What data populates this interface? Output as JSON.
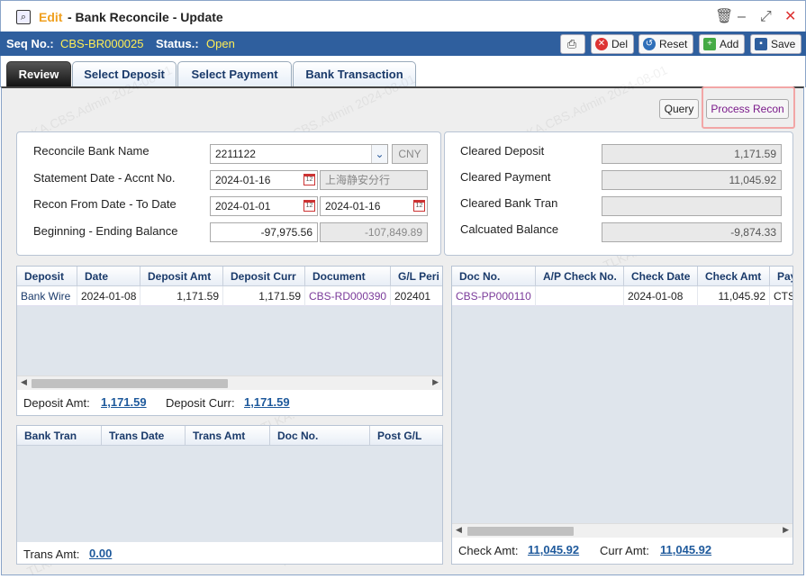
{
  "window": {
    "title_mode": "Edit",
    "title_rest": "- Bank Reconcile - Update",
    "controls": {
      "delete": "🗑",
      "minimize": "–",
      "maximize": "⤢",
      "close": "✕"
    }
  },
  "seqbar": {
    "seq_label": "Seq No.:",
    "seq_value": "CBS-BR000025",
    "status_label": "Status.:",
    "status_value": "Open",
    "buttons": {
      "print": "",
      "del": "Del",
      "reset": "Reset",
      "add": "Add",
      "save": "Save"
    }
  },
  "tabs": [
    "Review",
    "Select Deposit",
    "Select Payment",
    "Bank Transaction"
  ],
  "actions": {
    "query": "Query",
    "process": "Process Recon"
  },
  "form": {
    "bank_name_label": "Reconcile Bank Name",
    "bank_name": "2211122",
    "currency": "CNY",
    "stmt_label": "Statement Date - Accnt No.",
    "stmt_date": "2024-01-16",
    "accnt_no": "上海静安分行",
    "recon_label": "Recon From Date - To Date",
    "from_date": "2024-01-01",
    "to_date": "2024-01-16",
    "balance_label": "Beginning - Ending Balance",
    "beginning_balance": "-97,975.56",
    "ending_balance": "-107,849.89"
  },
  "summary": {
    "cleared_deposit_label": "Cleared Deposit",
    "cleared_deposit": "1,171.59",
    "cleared_payment_label": "Cleared Payment",
    "cleared_payment": "11,045.92",
    "cleared_bank_tran_label": "Cleared Bank Tran",
    "cleared_bank_tran": "",
    "calc_balance_label": "Calcuated Balance",
    "calc_balance": "-9,874.33"
  },
  "deposit_grid": {
    "columns": [
      "Deposit",
      "Date",
      "Deposit Amt",
      "Deposit Curr",
      "Document",
      "G/L Peri"
    ],
    "rows": [
      [
        "Bank Wire",
        "2024-01-08",
        "1,171.59",
        "1,171.59",
        "CBS-RD000390",
        "202401"
      ]
    ],
    "footer": {
      "amt_label": "Deposit Amt:",
      "amt": "1,171.59",
      "curr_label": "Deposit Curr:",
      "curr": "1,171.59"
    }
  },
  "bank_grid": {
    "columns": [
      "Bank Tran",
      "Trans Date",
      "Trans Amt",
      "Doc No.",
      "Post G/L"
    ],
    "footer": {
      "amt_label": "Trans Amt:",
      "amt": "0.00"
    }
  },
  "payment_grid": {
    "columns": [
      "Doc No.",
      "A/P Check No.",
      "Check Date",
      "Check Amt",
      "Pay"
    ],
    "rows": [
      [
        "CBS-PP000110",
        "",
        "2024-01-08",
        "11,045.92",
        "CTS"
      ]
    ],
    "footer": {
      "check_label": "Check Amt:",
      "check": "11,045.92",
      "curr_label": "Curr Amt:",
      "curr": "11,045.92"
    }
  },
  "watermark": "TLKA.CBS.Admin 2024-08-01",
  "colors": {
    "accent": "#2f5f9e",
    "title_mode": "#f0a020",
    "seq_value": "#ffee55",
    "link": "#1f5a9c",
    "doc_link": "#7a3a9a",
    "required": "#cc2222"
  }
}
